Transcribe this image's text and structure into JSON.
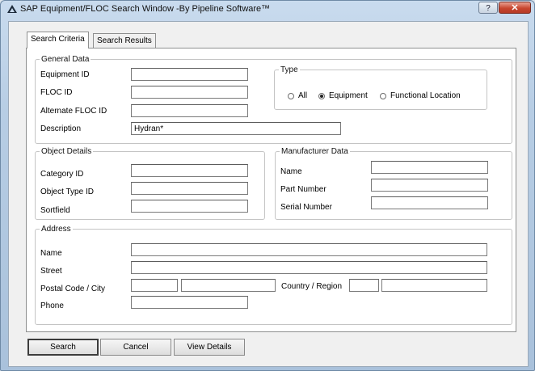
{
  "window": {
    "title": "SAP Equipment/FLOC Search Window  -By Pipeline Software™",
    "help_label": "?",
    "close_label": "✕"
  },
  "tabs": [
    {
      "label": "Search Criteria",
      "active": true
    },
    {
      "label": "Search Results",
      "active": false
    }
  ],
  "general_data": {
    "legend": "General Data",
    "equipment_id": {
      "label": "Equipment ID",
      "value": ""
    },
    "floc_id": {
      "label": "FLOC ID",
      "value": ""
    },
    "alternate_floc_id": {
      "label": "Alternate FLOC ID",
      "value": ""
    },
    "description": {
      "label": "Description",
      "value": "Hydran*"
    }
  },
  "type": {
    "legend": "Type",
    "options": [
      {
        "label": "All",
        "selected": false
      },
      {
        "label": "Equipment",
        "selected": true
      },
      {
        "label": "Functional Location",
        "selected": false
      }
    ]
  },
  "object_details": {
    "legend": "Object Details",
    "category_id": {
      "label": "Category ID",
      "value": ""
    },
    "object_type_id": {
      "label": "Object Type ID",
      "value": ""
    },
    "sortfield": {
      "label": "Sortfield",
      "value": ""
    }
  },
  "manufacturer_data": {
    "legend": "Manufacturer Data",
    "name": {
      "label": "Name",
      "value": ""
    },
    "part_number": {
      "label": "Part Number",
      "value": ""
    },
    "serial_number": {
      "label": "Serial Number",
      "value": ""
    }
  },
  "address": {
    "legend": "Address",
    "name": {
      "label": "Name",
      "value": ""
    },
    "street": {
      "label": "Street",
      "value": ""
    },
    "postal_city": {
      "label": "Postal Code / City",
      "postal_value": "",
      "city_value": ""
    },
    "country_region": {
      "label": "Country / Region",
      "country_value": "",
      "region_value": ""
    },
    "phone": {
      "label": "Phone",
      "value": ""
    }
  },
  "buttons": {
    "search": "Search",
    "cancel": "Cancel",
    "view_details": "View Details"
  }
}
